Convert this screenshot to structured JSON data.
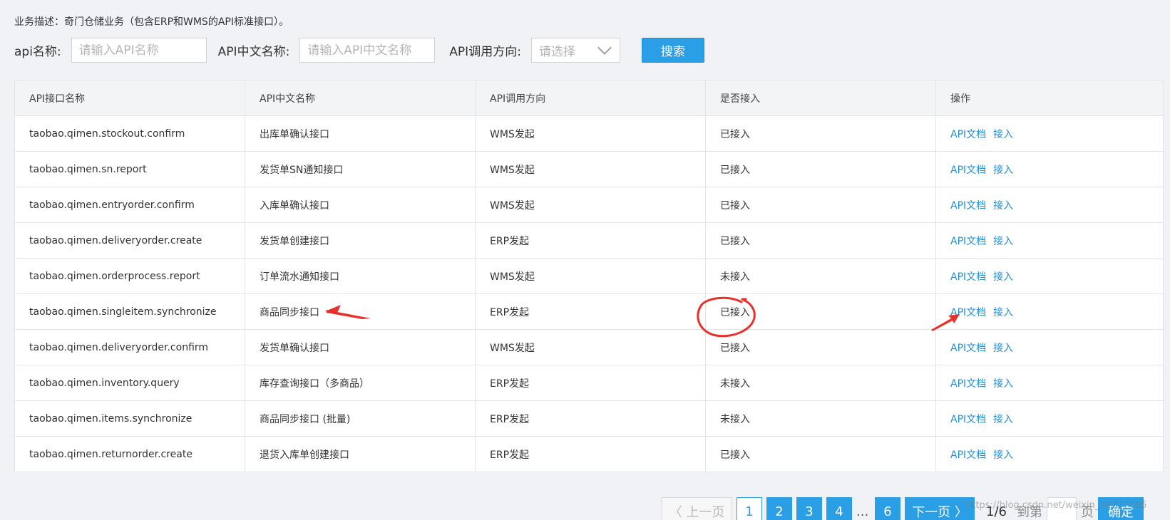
{
  "business_description": "业务描述：奇门仓储业务（包含ERP和WMS的API标准接口）。",
  "search": {
    "api_name_label": "api名称:",
    "api_name_placeholder": "请输入API名称",
    "api_cn_name_label": "API中文名称:",
    "api_cn_name_placeholder": "请输入API中文名称",
    "direction_label": "API调用方向:",
    "direction_selected": "请选择",
    "search_button": "搜索"
  },
  "table": {
    "headers": [
      "API接口名称",
      "API中文名称",
      "API调用方向",
      "是否接入",
      "操作"
    ],
    "rows": [
      {
        "api": "taobao.qimen.stockout.confirm",
        "cn": "出库单确认接口",
        "dir": "WMS发起",
        "status": "已接入"
      },
      {
        "api": "taobao.qimen.sn.report",
        "cn": "发货单SN通知接口",
        "dir": "WMS发起",
        "status": "已接入"
      },
      {
        "api": "taobao.qimen.entryorder.confirm",
        "cn": "入库单确认接口",
        "dir": "WMS发起",
        "status": "已接入"
      },
      {
        "api": "taobao.qimen.deliveryorder.create",
        "cn": "发货单创建接口",
        "dir": "ERP发起",
        "status": "已接入"
      },
      {
        "api": "taobao.qimen.orderprocess.report",
        "cn": "订单流水通知接口",
        "dir": "WMS发起",
        "status": "未接入"
      },
      {
        "api": "taobao.qimen.singleitem.synchronize",
        "cn": "商品同步接口",
        "dir": "ERP发起",
        "status": "已接入"
      },
      {
        "api": "taobao.qimen.deliveryorder.confirm",
        "cn": "发货单确认接口",
        "dir": "WMS发起",
        "status": "已接入"
      },
      {
        "api": "taobao.qimen.inventory.query",
        "cn": "库存查询接口（多商品）",
        "dir": "ERP发起",
        "status": "未接入"
      },
      {
        "api": "taobao.qimen.items.synchronize",
        "cn": "商品同步接口 (批量)",
        "dir": "ERP发起",
        "status": "未接入"
      },
      {
        "api": "taobao.qimen.returnorder.create",
        "cn": "退货入库单创建接口",
        "dir": "ERP发起",
        "status": "已接入"
      }
    ],
    "action_doc": "API文档",
    "action_connect": "接入"
  },
  "pagination": {
    "prev": "〈 上一页",
    "pages": [
      "1",
      "2",
      "3",
      "4"
    ],
    "ellipsis": "...",
    "last_page": "6",
    "next": "下一页 〉",
    "info": "1/6",
    "goto": "到第",
    "unit": "页",
    "confirm": "确定",
    "current_page": 1,
    "total_pages": 6
  },
  "watermark": "https://blog.csdn.net/weixin_44777665",
  "colors": {
    "accent": "#2b9fe6",
    "annotation": "#e8312b"
  }
}
